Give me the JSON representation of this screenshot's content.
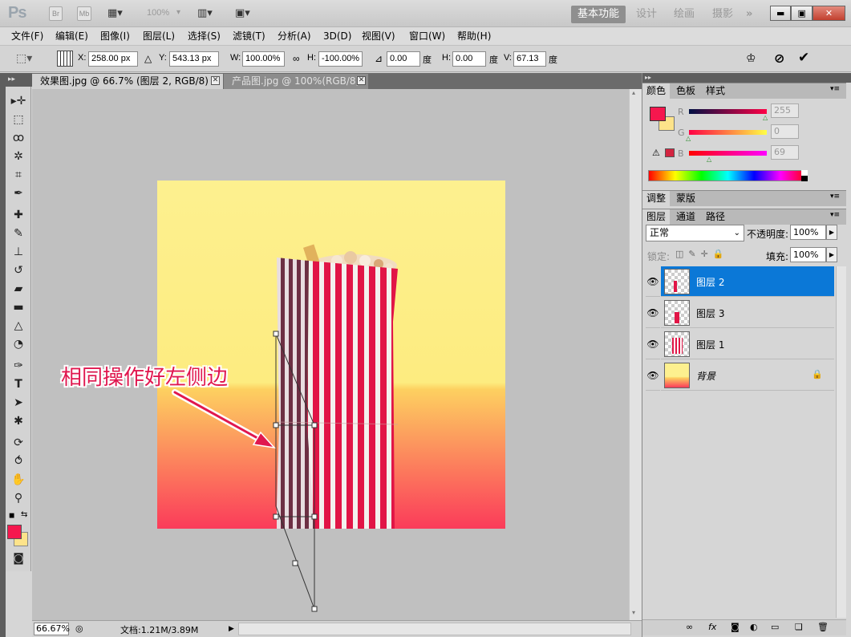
{
  "app": {
    "logo": "Ps"
  },
  "titlebar": {
    "br": "Br",
    "mb": "Mb",
    "zoom": "100%",
    "workspaces": [
      "基本功能",
      "设计",
      "绘画",
      "摄影"
    ],
    "more": "»",
    "window_buttons": {
      "minimize": "▬",
      "maximize": "▣",
      "close": "✕"
    }
  },
  "menu": [
    "文件(F)",
    "编辑(E)",
    "图像(I)",
    "图层(L)",
    "选择(S)",
    "滤镜(T)",
    "分析(A)",
    "3D(D)",
    "视图(V)",
    "窗口(W)",
    "帮助(H)"
  ],
  "options": {
    "x_label": "X:",
    "x": "258.00 px",
    "y_label": "Y:",
    "y": "543.13 px",
    "w_label": "W:",
    "w": "100.00%",
    "h_label": "H:",
    "h": "-100.00%",
    "angle": "0.00",
    "deg1": "度",
    "hskew_label": "H:",
    "hskew": "0.00",
    "deg2": "度",
    "vskew_label": "V:",
    "vskew": "67.13",
    "deg3": "度"
  },
  "doc_tabs": [
    {
      "label": "效果图.jpg @ 66.7% (图层 2, RGB/8) *",
      "active": true
    },
    {
      "label": "产品图.jpg @ 100%(RGB/8)",
      "active": false
    }
  ],
  "annotation": {
    "text": "相同操作好左侧边",
    "color": "#e0174f"
  },
  "colors": {
    "foreground": "#f5174e",
    "background": "#fde38a",
    "canvas_top": "#fdf08f",
    "canvas_mid": "#fdd060",
    "canvas_bottom": "#fb3b5a",
    "selection_blue": "#0b78d7"
  },
  "color_panel": {
    "tabs": [
      "颜色",
      "色板",
      "样式"
    ],
    "r_label": "R",
    "r": "255",
    "g_label": "G",
    "g": "0",
    "b_label": "B",
    "b": "69"
  },
  "adjust_panel": {
    "tabs": [
      "调整",
      "蒙版"
    ]
  },
  "layers_panel": {
    "tabs": [
      "图层",
      "通道",
      "路径"
    ],
    "blend_mode": "正常",
    "opacity_label": "不透明度:",
    "opacity": "100%",
    "lock_label": "锁定:",
    "fill_label": "填充:",
    "fill": "100%",
    "layers": [
      {
        "name": "图层 2",
        "selected": true
      },
      {
        "name": "图层 3",
        "selected": false
      },
      {
        "name": "图层 1",
        "selected": false
      },
      {
        "name": "背景",
        "selected": false
      }
    ]
  },
  "status": {
    "zoom": "66.67%",
    "doc": "文档:1.21M/3.89M"
  }
}
